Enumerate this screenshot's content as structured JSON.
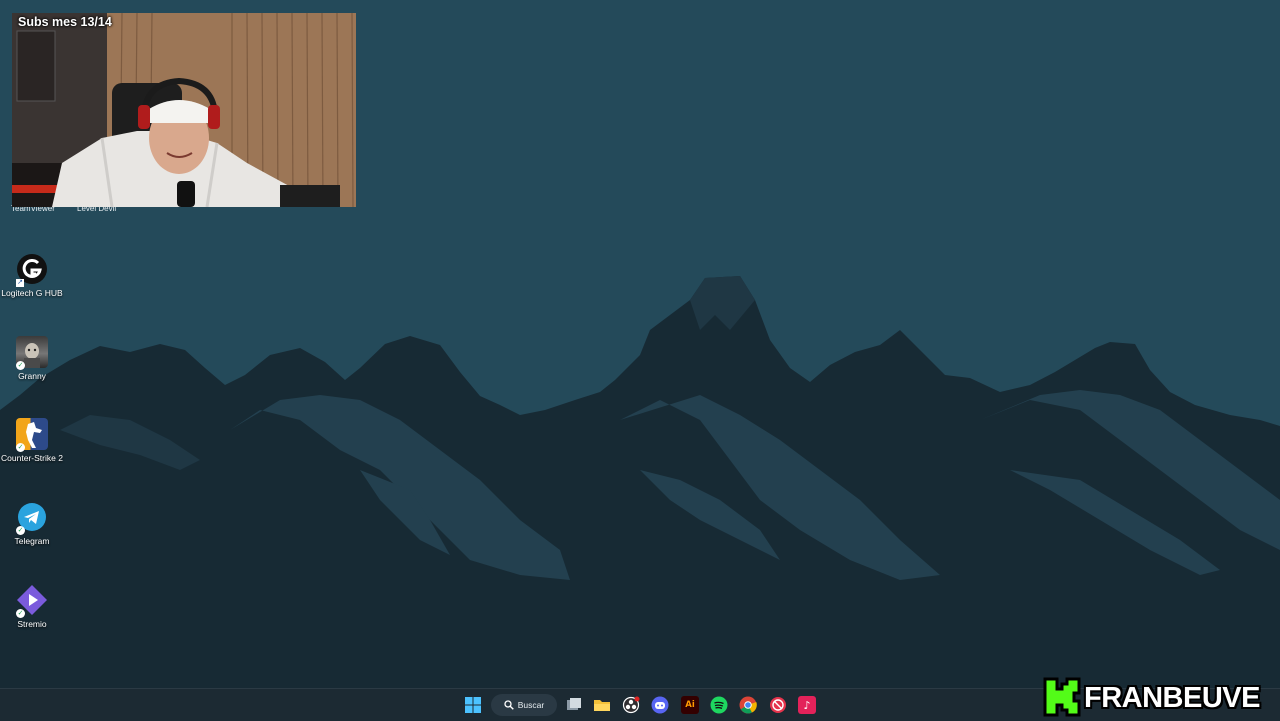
{
  "webcam": {
    "overlay_text": "Subs mes 13/14"
  },
  "desktop": {
    "partial_labels": [
      "TeamViewer",
      "Level Devil"
    ],
    "icons": [
      {
        "label": "Logitech G HUB",
        "icon": "logitech-ghub-icon"
      },
      {
        "label": "Granny",
        "icon": "granny-icon"
      },
      {
        "label": "Counter-Strike 2",
        "icon": "counter-strike-icon"
      },
      {
        "label": "Telegram",
        "icon": "telegram-icon"
      },
      {
        "label": "Stremio",
        "icon": "stremio-icon"
      }
    ]
  },
  "taskbar": {
    "search_label": "Buscar",
    "apps": [
      "start-icon",
      "task-view-icon",
      "file-explorer-icon",
      "obs-icon",
      "discord-icon",
      "adobe-illustrator-icon",
      "spotify-icon",
      "chrome-icon",
      "app-icon",
      "tiktok-icon"
    ]
  },
  "watermark": {
    "brand": "FRANBEUVE",
    "letter": "K"
  },
  "colors": {
    "sky": "#244a5a",
    "mountains": "#172a34",
    "snow": "#23404f",
    "taskbar": "#1c2a33",
    "logo_green": "#53fc18"
  }
}
